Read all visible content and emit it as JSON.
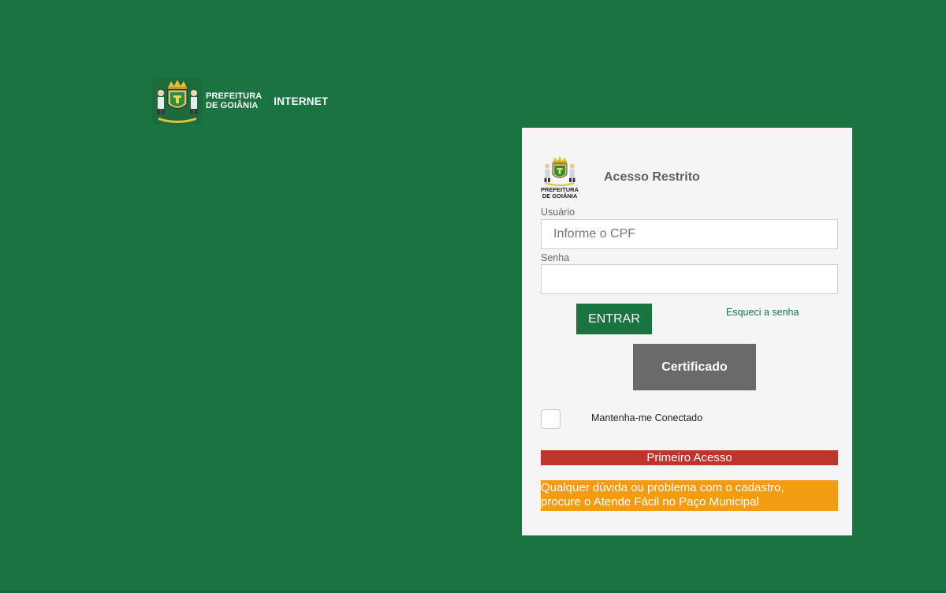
{
  "header": {
    "logo_line1": "PREFEITURA",
    "logo_line2": "DE GOIÂNIA",
    "logo_suffix": "INTERNET"
  },
  "login": {
    "crest_line1": "PREFEITURA",
    "crest_line2": "DE GOIÂNIA",
    "title": "Acesso Restrito",
    "user_label": "Usuário",
    "user_placeholder": "Informe o CPF",
    "user_value": "",
    "password_label": "Senha",
    "password_value": "",
    "submit_label": "ENTRAR",
    "forgot_label": "Esqueci a senha",
    "certificate_label": "Certificado",
    "remember_label": "Mantenha-me Conectado",
    "remember_checked": false,
    "first_access_label": "Primeiro Acesso",
    "help_line1": "Qualquer dúvida ou problema com o cadastro,",
    "help_line2": "procure o Atende Fácil no Paço Municipal"
  },
  "colors": {
    "background": "#1a7441",
    "panel": "#f5f5f5",
    "primary_button": "#1a7441",
    "certificate_button": "#6a6a6a",
    "first_access": "#c0352b",
    "notice": "#f39c12"
  },
  "icons": {
    "header_crest": "coat-of-arms-icon",
    "panel_crest": "coat-of-arms-icon"
  }
}
